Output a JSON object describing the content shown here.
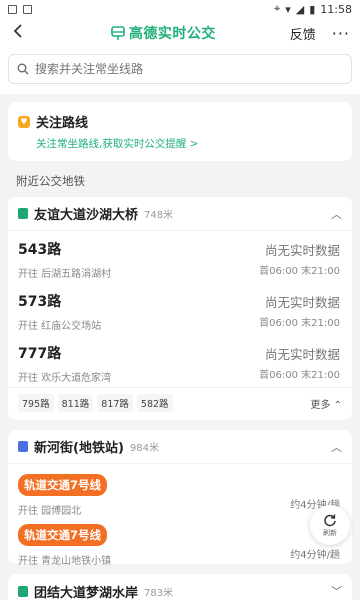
{
  "status_bar": {
    "time": "11:58"
  },
  "nav": {
    "title": "高德实时公交",
    "feedback": "反馈",
    "more": "···"
  },
  "search": {
    "placeholder": "搜索并关注常坐线路"
  },
  "follow": {
    "title": "关注路线",
    "subtitle": "关注常坐路线,获取实时公交提醒 >"
  },
  "nearby_label": "附近公交地铁",
  "stop1": {
    "name": "友谊大道沙湖大桥",
    "distance": "748米",
    "routes": [
      {
        "name": "543路",
        "direction": "开往 后湖五路涓湖村",
        "status": "尚无实时数据",
        "time": "首06:00 末21:00"
      },
      {
        "name": "573路",
        "direction": "开往 红庙公交场站",
        "status": "尚无实时数据",
        "time": "首06:00 末21:00"
      },
      {
        "name": "777路",
        "direction": "开往 欢乐大道危家湾",
        "status": "尚无实时数据",
        "time": "首06:00 末21:00"
      }
    ],
    "chips": [
      "795路",
      "811路",
      "817路",
      "582路"
    ],
    "more": "更多"
  },
  "stop2": {
    "name": "新河街(地铁站)",
    "distance": "984米",
    "lines": [
      {
        "badge": "轨道交通7号线",
        "direction": "开往 园博园北",
        "eta": "约4分钟/趟"
      },
      {
        "badge": "轨道交通7号线",
        "direction": "开往 青龙山地铁小镇",
        "eta": "约4分钟/趟"
      }
    ]
  },
  "stop3": {
    "name": "团结大道梦湖水岸",
    "distance": "783米"
  },
  "refresh_label": "刷新",
  "colors": {
    "brand": "#21b07a",
    "badge": "#f36f24",
    "subway_icon": "#4a6fe3"
  }
}
